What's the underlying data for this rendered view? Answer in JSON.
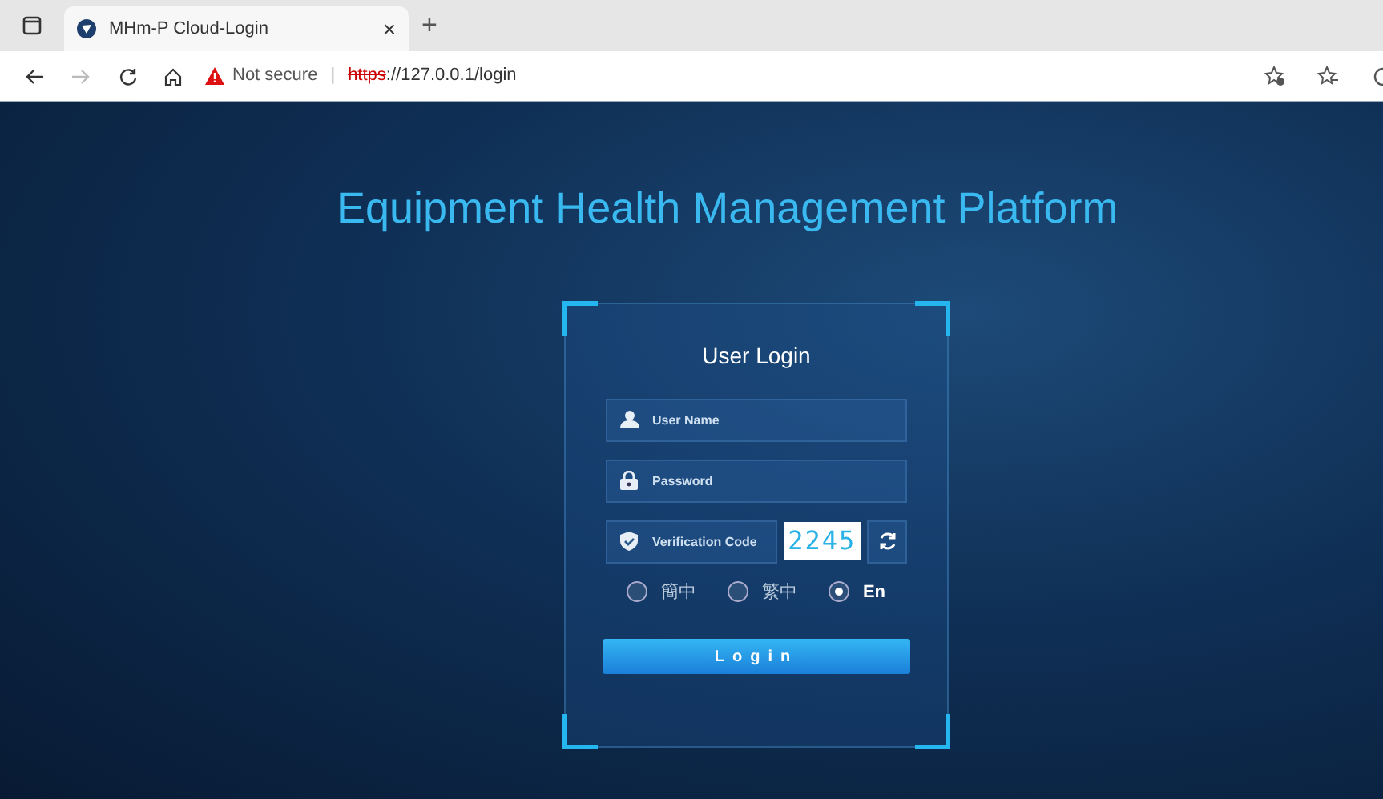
{
  "browser": {
    "tab": {
      "title": "MHm-P Cloud-Login",
      "close": "×",
      "new_tab": "+"
    },
    "address_bar": {
      "security": "Not secure",
      "separator": "|",
      "scheme": "https",
      "rest": "://127.0.0.1/login"
    }
  },
  "page": {
    "title": "Equipment Health Management Platform",
    "login": {
      "heading": "User Login",
      "fields": [
        {
          "kind": "username",
          "placeholder": "User Name"
        },
        {
          "kind": "password",
          "placeholder": "Password"
        },
        {
          "kind": "captcha",
          "placeholder": "Verification Code",
          "code": "2245"
        }
      ],
      "languages": [
        {
          "label": "簡中",
          "selected": false
        },
        {
          "label": "繁中",
          "selected": false
        },
        {
          "label": "En",
          "selected": true
        }
      ],
      "button": "Login"
    }
  }
}
